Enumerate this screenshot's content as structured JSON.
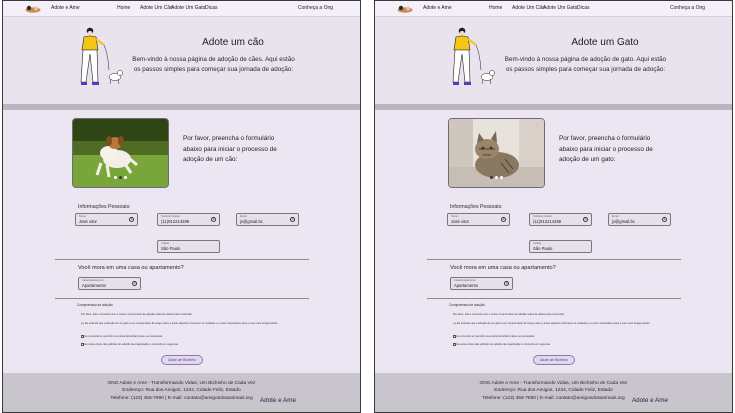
{
  "panels": [
    {
      "brand": "Adote e Ame",
      "nav": [
        "Home",
        "Adote Um Cão",
        "Adote Um Gato",
        "Dicas"
      ],
      "nav_right": "Conheça a Ong",
      "title": "Adote um cão",
      "text": "Bem-vindo à nossa página de adoção de cães. Aqui estão os passos simples para começar sua jornada de adoção:",
      "image_icon": "dog-photo",
      "carousel_active": 1,
      "intro": "Por favor, preencha o formulário abaixo para iniciar o processo de adoção de um cão:",
      "form_title": "Informações Pessoais:",
      "fields": {
        "nome": {
          "label": "Nome",
          "value": "José vitor"
        },
        "tel": {
          "label": "Telefone Celular",
          "value": "(11)912214289"
        },
        "email": {
          "label": "Email",
          "value": "jv@gmail.bc"
        },
        "cidade": {
          "label": "Cidade",
          "value": "São Paulo"
        }
      },
      "q_house": "Você mora em uma casa ou apartamento?",
      "house": {
        "label": "Casa/Apartamento",
        "value": "Apartamento"
      },
      "commit_title": "Compromisso de adoção:",
      "commit": [
        "Por favor, leia e concorde com o nosso compromisso de adoção antes de adotar para concordar:",
        "(+) Eu entendo que a adoção de um gato é um compromisso de longo prazo e estou disposto a fornecer os cuidados e o amor necessários para o meu novo amigo peludo.",
        "Eu concordo em permitir uma visita domiciliar prévia, se necessária.",
        "Eu estou ciente das políticas de adoção da organização e concordo em seguí-las."
      ],
      "submit": "Adote um Bichinho",
      "footer": [
        "ONG Adote e Ame - Transformando Vidas, Um Bichinho de Cada Vez",
        "Endereço: Rua dos Amigos, 1234, Cidade Feliz, Estado",
        "Telefone: (123) 456-7890 | E-mail: contato@amigosdosanimais.org"
      ],
      "footer_brand": "Adote e Ame"
    },
    {
      "brand": "Adote e Ame",
      "nav": [
        "Home",
        "Adote Um Cão",
        "Adote Um Gato",
        "Dicas"
      ],
      "nav_right": "Conheça a Ong",
      "title": "Adote um Gato",
      "text": "Bem-vindo à nossa página de adoção de gato. Aqui estão os passos simples para começar sua jornada de adoção:",
      "image_icon": "cat-photo",
      "carousel_active": 0,
      "intro": "Por favor, preencha o formulário abaixo para iniciar o processo de adoção de um gato:",
      "form_title": "Informações Pessoais:",
      "fields": {
        "nome": {
          "label": "Nome",
          "value": "José vitor"
        },
        "tel": {
          "label": "Telefone Celular",
          "value": "(11)912214289"
        },
        "email": {
          "label": "Email",
          "value": "jv@gmail.bc"
        },
        "cidade": {
          "label": "Cidade",
          "value": "São Paulo"
        }
      },
      "q_house": "Você mora em uma casa ou apartamento?",
      "house": {
        "label": "Casa/Apartamento",
        "value": "Apartamento"
      },
      "commit_title": "Compromisso de adoção:",
      "commit": [
        "Por favor, leia e concorde com o nosso compromisso de adoção antes de adotar para concordar:",
        "(+) Eu entendo que a adoção de um gato é um compromisso de longo prazo e estou disposto a fornecer os cuidados e o amor necessários para o meu novo amigo peludo.",
        "Eu concordo em permitir uma visita domiciliar prévia, se necessária.",
        "Eu estou ciente das políticas de adoção da organização e concordo em seguí-las."
      ],
      "submit": "Adote um Bichinho",
      "footer": [
        "ONG Adote e Ame - Transformando Vidas, Um Bichinho de Cada Vez",
        "Endereço: Rua dos Amigos, 1234, Cidade Feliz, Estado",
        "Telefone: (123) 456-7890 | E-mail: contato@amigosdosanimais.org"
      ],
      "footer_brand": "Adote e Ame"
    }
  ]
}
